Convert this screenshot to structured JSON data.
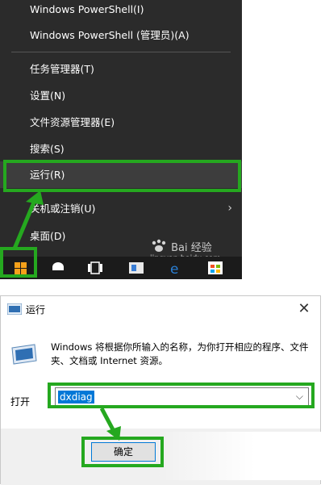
{
  "winx_menu": {
    "items": [
      {
        "label": "Windows PowerShell(I)"
      },
      {
        "label": "Windows PowerShell (管理员)(A)"
      },
      {
        "label": "任务管理器(T)"
      },
      {
        "label": "设置(N)"
      },
      {
        "label": "文件资源管理器(E)"
      },
      {
        "label": "搜索(S)"
      },
      {
        "label": "运行(R)"
      },
      {
        "label": "关机或注销(U)"
      },
      {
        "label": "桌面(D)"
      }
    ],
    "submenu_arrow": "›"
  },
  "watermark": {
    "brand": "Bai 经验",
    "site": "jingyan.baidu.com"
  },
  "taskbar": {
    "start_icon": "windows-logo-icon",
    "icons": [
      "cortana-icon",
      "task-view-icon",
      "app-icon",
      "edge-icon",
      "store-icon"
    ]
  },
  "run_dialog": {
    "title": "运行",
    "close": "✕",
    "description": "Windows 将根据你所输入的名称，为你打开相应的程序、文件夹、文档或 Internet 资源。",
    "open_label": "打开",
    "input_value": "dxdiag",
    "chevron": "⌵",
    "ok_label": "确定"
  },
  "colors": {
    "highlight_green": "#25a81f",
    "menu_bg": "#2b2b2b",
    "selection_blue": "#0078d7"
  }
}
